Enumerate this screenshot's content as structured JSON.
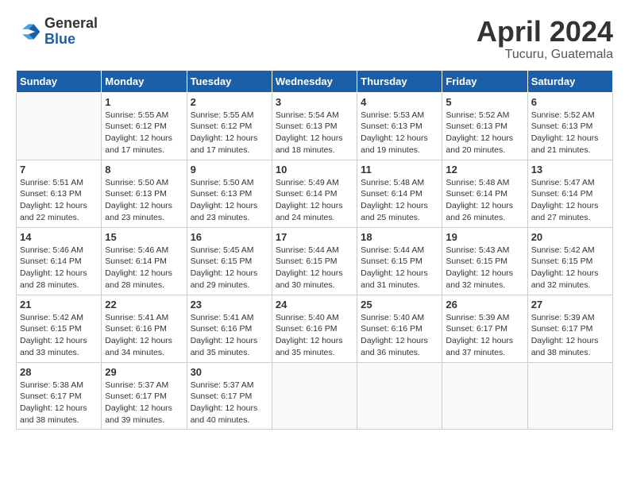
{
  "header": {
    "logo_general": "General",
    "logo_blue": "Blue",
    "month_title": "April 2024",
    "location": "Tucuru, Guatemala"
  },
  "weekdays": [
    "Sunday",
    "Monday",
    "Tuesday",
    "Wednesday",
    "Thursday",
    "Friday",
    "Saturday"
  ],
  "weeks": [
    [
      {
        "day": "",
        "info": ""
      },
      {
        "day": "1",
        "info": "Sunrise: 5:55 AM\nSunset: 6:12 PM\nDaylight: 12 hours\nand 17 minutes."
      },
      {
        "day": "2",
        "info": "Sunrise: 5:55 AM\nSunset: 6:12 PM\nDaylight: 12 hours\nand 17 minutes."
      },
      {
        "day": "3",
        "info": "Sunrise: 5:54 AM\nSunset: 6:13 PM\nDaylight: 12 hours\nand 18 minutes."
      },
      {
        "day": "4",
        "info": "Sunrise: 5:53 AM\nSunset: 6:13 PM\nDaylight: 12 hours\nand 19 minutes."
      },
      {
        "day": "5",
        "info": "Sunrise: 5:52 AM\nSunset: 6:13 PM\nDaylight: 12 hours\nand 20 minutes."
      },
      {
        "day": "6",
        "info": "Sunrise: 5:52 AM\nSunset: 6:13 PM\nDaylight: 12 hours\nand 21 minutes."
      }
    ],
    [
      {
        "day": "7",
        "info": "Sunrise: 5:51 AM\nSunset: 6:13 PM\nDaylight: 12 hours\nand 22 minutes."
      },
      {
        "day": "8",
        "info": "Sunrise: 5:50 AM\nSunset: 6:13 PM\nDaylight: 12 hours\nand 23 minutes."
      },
      {
        "day": "9",
        "info": "Sunrise: 5:50 AM\nSunset: 6:13 PM\nDaylight: 12 hours\nand 23 minutes."
      },
      {
        "day": "10",
        "info": "Sunrise: 5:49 AM\nSunset: 6:14 PM\nDaylight: 12 hours\nand 24 minutes."
      },
      {
        "day": "11",
        "info": "Sunrise: 5:48 AM\nSunset: 6:14 PM\nDaylight: 12 hours\nand 25 minutes."
      },
      {
        "day": "12",
        "info": "Sunrise: 5:48 AM\nSunset: 6:14 PM\nDaylight: 12 hours\nand 26 minutes."
      },
      {
        "day": "13",
        "info": "Sunrise: 5:47 AM\nSunset: 6:14 PM\nDaylight: 12 hours\nand 27 minutes."
      }
    ],
    [
      {
        "day": "14",
        "info": "Sunrise: 5:46 AM\nSunset: 6:14 PM\nDaylight: 12 hours\nand 28 minutes."
      },
      {
        "day": "15",
        "info": "Sunrise: 5:46 AM\nSunset: 6:14 PM\nDaylight: 12 hours\nand 28 minutes."
      },
      {
        "day": "16",
        "info": "Sunrise: 5:45 AM\nSunset: 6:15 PM\nDaylight: 12 hours\nand 29 minutes."
      },
      {
        "day": "17",
        "info": "Sunrise: 5:44 AM\nSunset: 6:15 PM\nDaylight: 12 hours\nand 30 minutes."
      },
      {
        "day": "18",
        "info": "Sunrise: 5:44 AM\nSunset: 6:15 PM\nDaylight: 12 hours\nand 31 minutes."
      },
      {
        "day": "19",
        "info": "Sunrise: 5:43 AM\nSunset: 6:15 PM\nDaylight: 12 hours\nand 32 minutes."
      },
      {
        "day": "20",
        "info": "Sunrise: 5:42 AM\nSunset: 6:15 PM\nDaylight: 12 hours\nand 32 minutes."
      }
    ],
    [
      {
        "day": "21",
        "info": "Sunrise: 5:42 AM\nSunset: 6:15 PM\nDaylight: 12 hours\nand 33 minutes."
      },
      {
        "day": "22",
        "info": "Sunrise: 5:41 AM\nSunset: 6:16 PM\nDaylight: 12 hours\nand 34 minutes."
      },
      {
        "day": "23",
        "info": "Sunrise: 5:41 AM\nSunset: 6:16 PM\nDaylight: 12 hours\nand 35 minutes."
      },
      {
        "day": "24",
        "info": "Sunrise: 5:40 AM\nSunset: 6:16 PM\nDaylight: 12 hours\nand 35 minutes."
      },
      {
        "day": "25",
        "info": "Sunrise: 5:40 AM\nSunset: 6:16 PM\nDaylight: 12 hours\nand 36 minutes."
      },
      {
        "day": "26",
        "info": "Sunrise: 5:39 AM\nSunset: 6:17 PM\nDaylight: 12 hours\nand 37 minutes."
      },
      {
        "day": "27",
        "info": "Sunrise: 5:39 AM\nSunset: 6:17 PM\nDaylight: 12 hours\nand 38 minutes."
      }
    ],
    [
      {
        "day": "28",
        "info": "Sunrise: 5:38 AM\nSunset: 6:17 PM\nDaylight: 12 hours\nand 38 minutes."
      },
      {
        "day": "29",
        "info": "Sunrise: 5:37 AM\nSunset: 6:17 PM\nDaylight: 12 hours\nand 39 minutes."
      },
      {
        "day": "30",
        "info": "Sunrise: 5:37 AM\nSunset: 6:17 PM\nDaylight: 12 hours\nand 40 minutes."
      },
      {
        "day": "",
        "info": ""
      },
      {
        "day": "",
        "info": ""
      },
      {
        "day": "",
        "info": ""
      },
      {
        "day": "",
        "info": ""
      }
    ]
  ]
}
